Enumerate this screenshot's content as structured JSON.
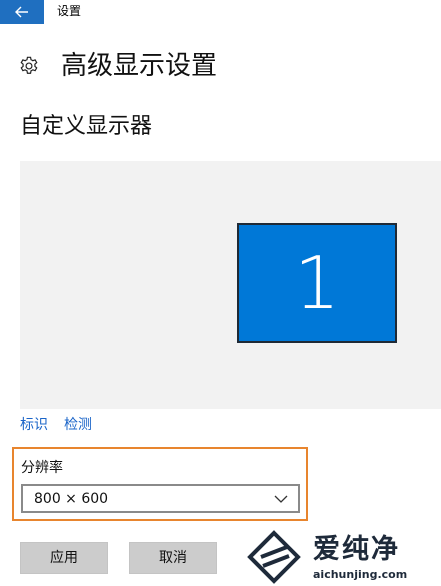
{
  "window": {
    "title": "设置",
    "back_icon": "arrow-left-icon",
    "accent_color": "#1f6fc0"
  },
  "header": {
    "icon": "gear-icon",
    "title": "高级显示设置"
  },
  "customize": {
    "title": "自定义显示器",
    "monitor_number": "1",
    "monitor_color": "#0078d7",
    "links": {
      "identify": "标识",
      "detect": "检测"
    }
  },
  "resolution": {
    "label": "分辨率",
    "value": "800 × 600",
    "highlight_color": "#e8852e"
  },
  "buttons": {
    "apply": "应用",
    "cancel": "取消"
  },
  "watermark": {
    "title": "爱纯净",
    "url": "aichunjing.com"
  }
}
